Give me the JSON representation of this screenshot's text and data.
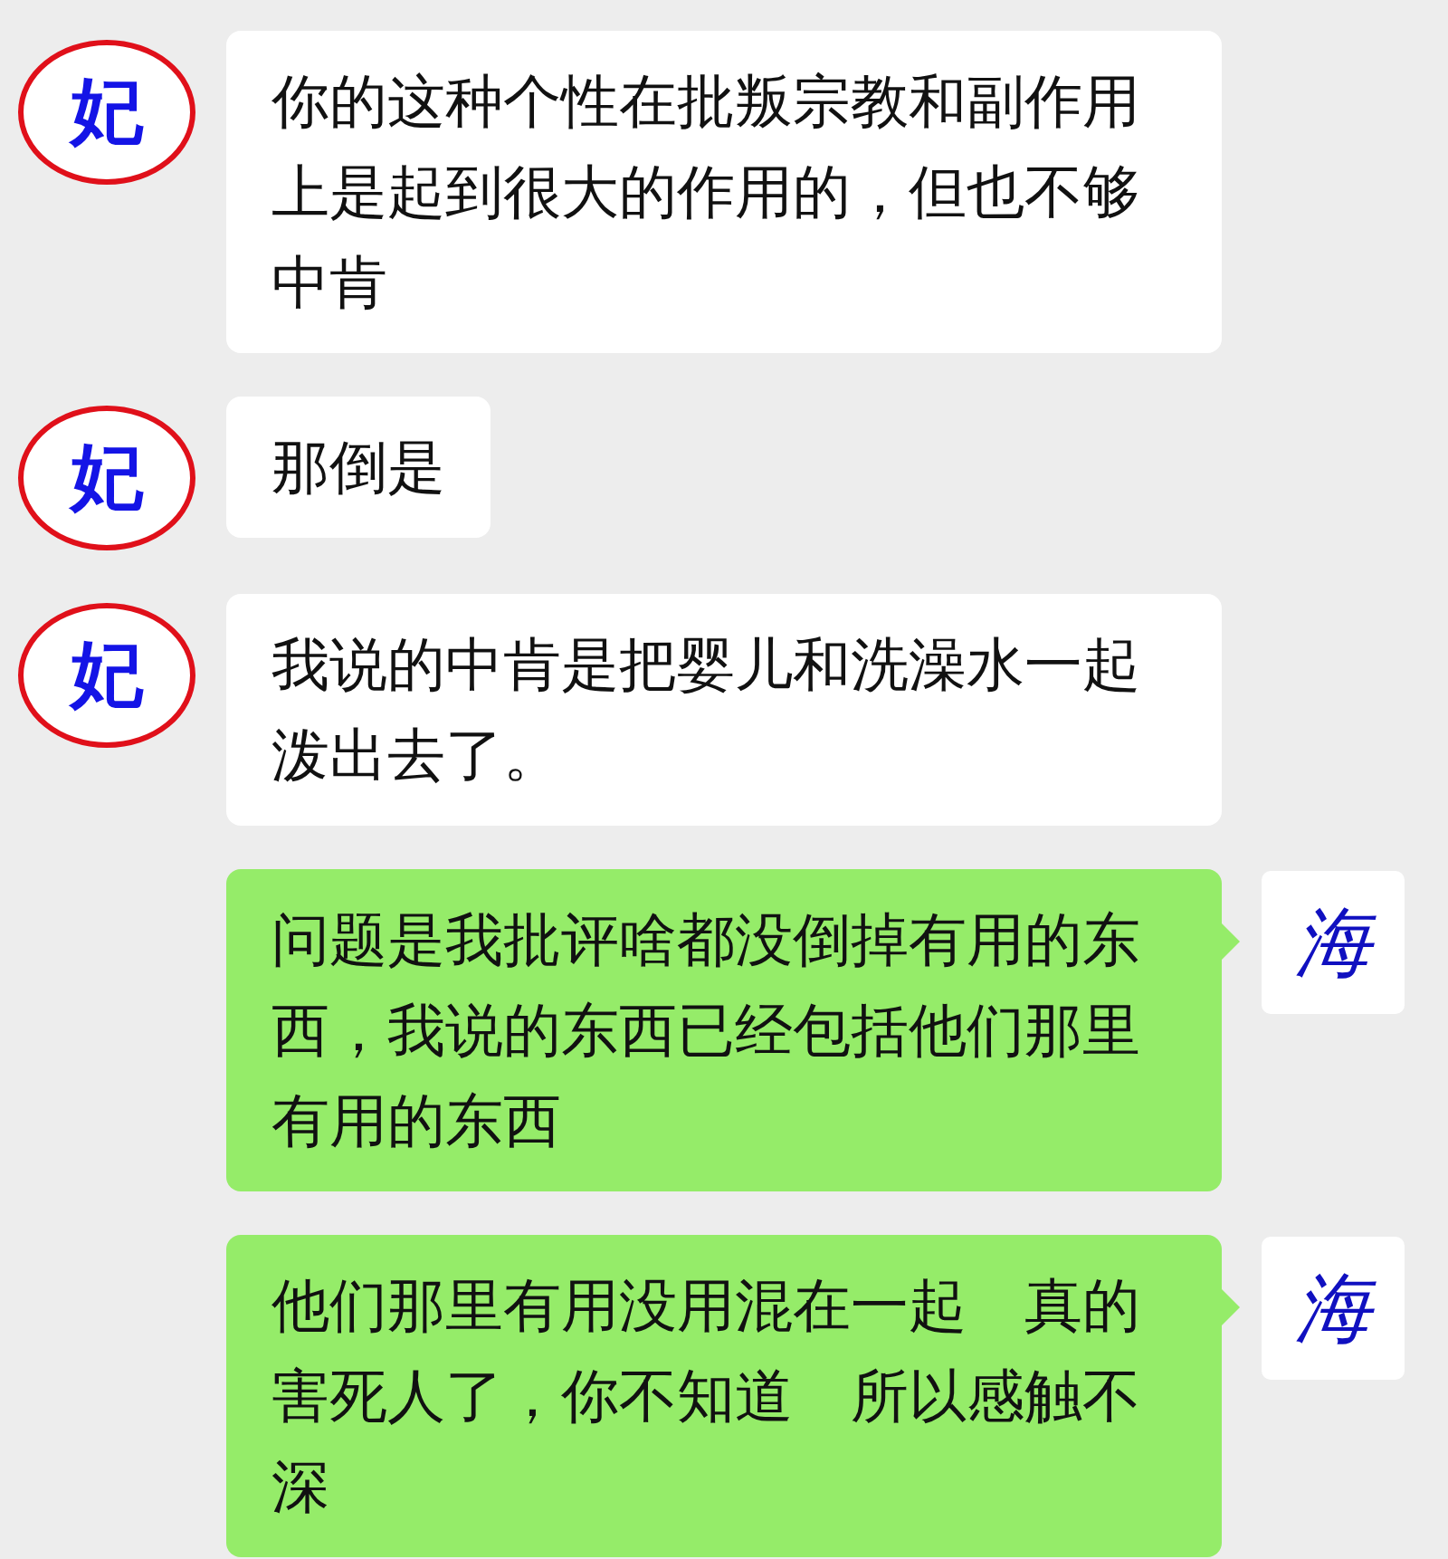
{
  "messages": [
    {
      "kind": "other",
      "avatar": "妃",
      "text": "你的这种个性在批叛宗教和副作用上是起到很大的作用的，但也不够中肯"
    },
    {
      "kind": "other",
      "avatar": "妃",
      "text": "那倒是"
    },
    {
      "kind": "other",
      "avatar": "妃",
      "text": "我说的中肯是把婴儿和洗澡水一起泼出去了。"
    },
    {
      "kind": "self",
      "avatar": "海",
      "text": "问题是我批评啥都没倒掉有用的东西，我说的东西已经包括他们那里有用的东西"
    },
    {
      "kind": "self",
      "avatar": "海",
      "text": "他们那里有用没用混在一起　真的害死人了，你不知道　所以感触不深"
    }
  ]
}
